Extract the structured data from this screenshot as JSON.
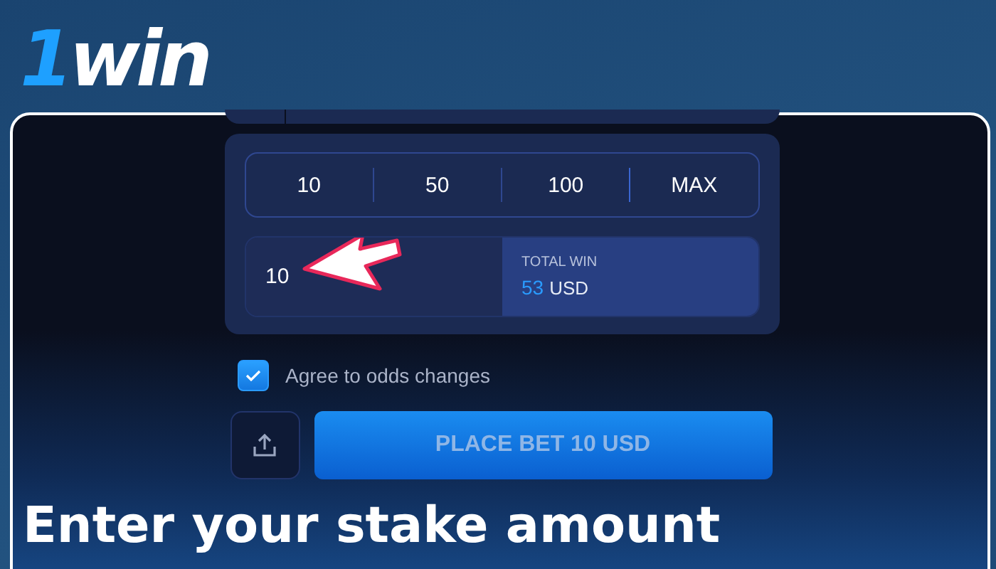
{
  "logo": "1win",
  "quick_amounts": [
    "10",
    "50",
    "100",
    "MAX"
  ],
  "stake": {
    "value": "10"
  },
  "total_win": {
    "label": "TOTAL WIN",
    "amount": "53",
    "currency": "USD"
  },
  "odds_checkbox": {
    "label": "Agree to odds changes",
    "checked": true
  },
  "place_bet_button": "PLACE BET 10 USD",
  "caption": "Enter your stake amount"
}
